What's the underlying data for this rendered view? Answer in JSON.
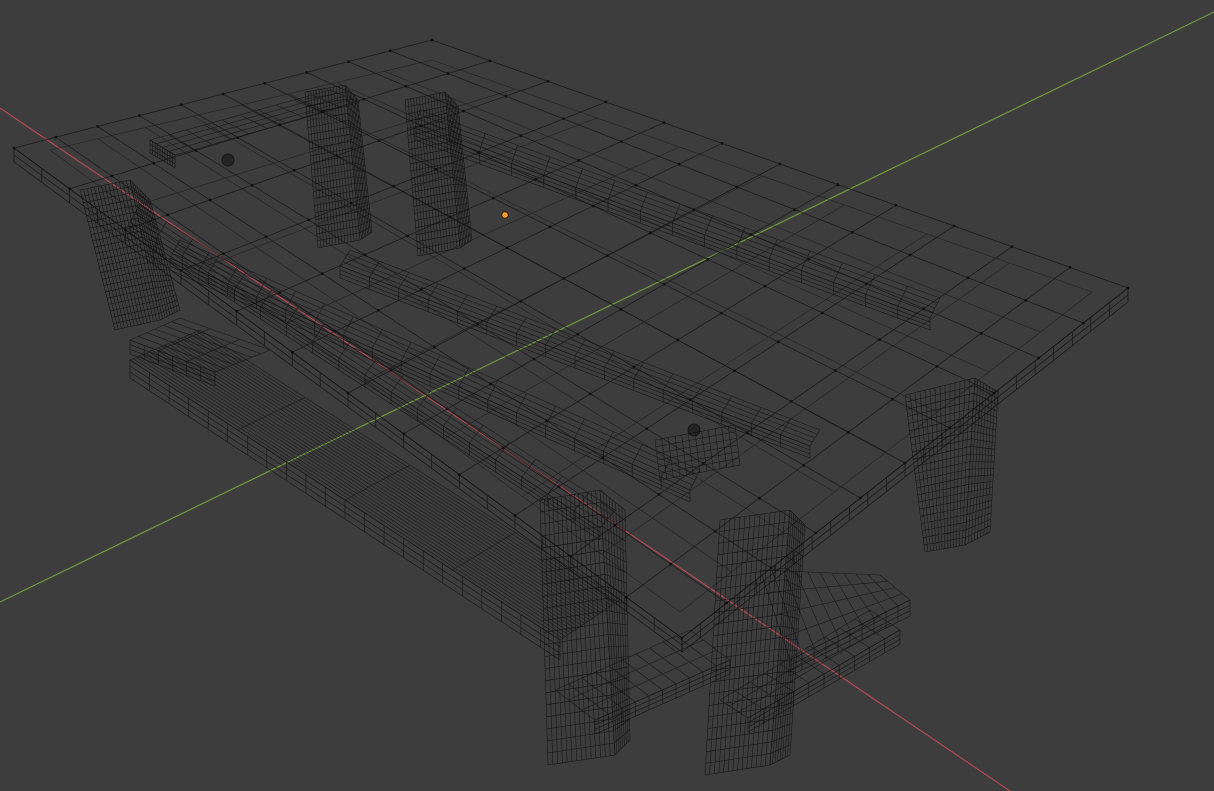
{
  "viewport": {
    "mode": "wireframe",
    "background_color": "#3d3d3d",
    "wire_color": "#111111",
    "x_axis_color": "#b24a52",
    "y_axis_color": "#6f9a3c",
    "origin_color": "#ff9a2e"
  },
  "scene": {
    "object": "picnic-table-with-benches",
    "parts": [
      "table-top",
      "table-leg-back-left",
      "table-leg-back-right",
      "table-leg-front-left",
      "table-leg-front-right",
      "bench-back",
      "bench-front",
      "bench-leg"
    ]
  }
}
